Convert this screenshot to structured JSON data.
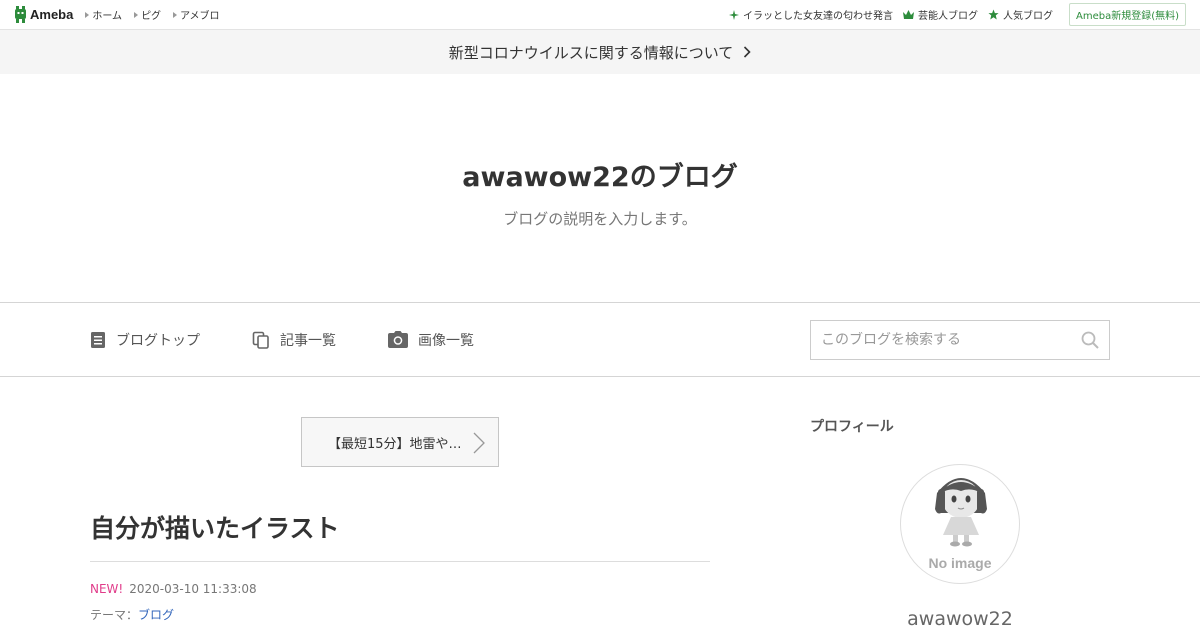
{
  "topbar": {
    "logo_text": "Ameba",
    "nav_left": [
      "ホーム",
      "ピグ",
      "アメブロ"
    ],
    "nav_right": [
      {
        "icon": "sparkle-icon",
        "label": "イラッとした女友達の匂わせ発言"
      },
      {
        "icon": "crown-icon",
        "label": "芸能人ブログ"
      },
      {
        "icon": "star-icon",
        "label": "人気ブログ"
      }
    ],
    "register_label": "Ameba新規登録(無料)"
  },
  "announcement": {
    "text": "新型コロナウイルスに関する情報について"
  },
  "header": {
    "title": "awawow22のブログ",
    "description": "ブログの説明を入力します。"
  },
  "blog_nav": {
    "tabs": [
      {
        "icon": "document-icon",
        "label": "ブログトップ"
      },
      {
        "icon": "copy-icon",
        "label": "記事一覧"
      },
      {
        "icon": "camera-icon",
        "label": "画像一覧"
      }
    ],
    "search_placeholder": "このブログを検索する"
  },
  "article": {
    "next_link": "【最短15分】地雷や…",
    "title": "自分が描いたイラスト",
    "new_badge": "NEW!",
    "timestamp": "2020-03-10 11:33:08",
    "theme_label": "テーマ：",
    "theme_value": "ブログ"
  },
  "sidebar": {
    "heading": "プロフィール",
    "avatar_text": "No image",
    "username": "awawow22"
  },
  "colors": {
    "accent_green": "#2d8c3c",
    "new_pink": "#e03c8a",
    "link_blue": "#3366bb"
  }
}
